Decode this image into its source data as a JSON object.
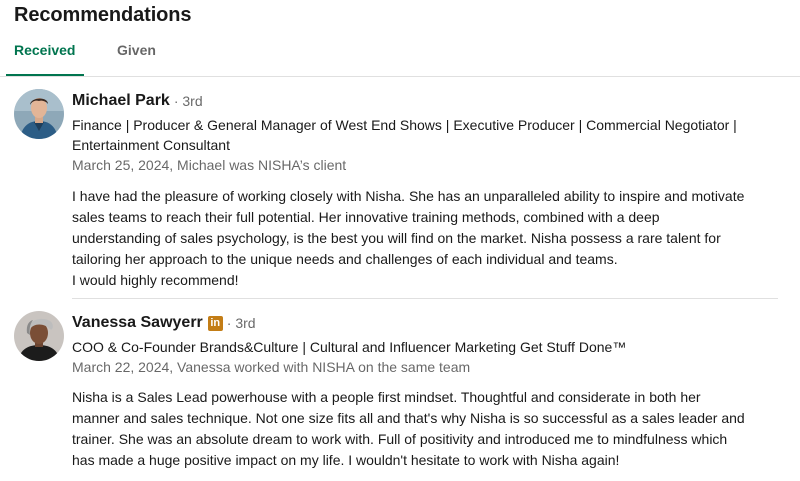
{
  "section": {
    "title": "Recommendations"
  },
  "tabs": [
    {
      "label": "Received",
      "active": true
    },
    {
      "label": "Given",
      "active": false
    }
  ],
  "accent_color": "#01754f",
  "recommendations": [
    {
      "name": "Michael Park",
      "degree": "· 3rd",
      "headline": "Finance | Producer & General Manager of West End Shows | Executive Producer | Commercial Negotiator | Entertainment Consultant",
      "meta": "March 25, 2024, Michael was NISHA’s client",
      "body_lines": [
        "I have had the pleasure of working closely with Nisha. She has an unparalleled ability to inspire and motivate",
        "sales teams to reach their full potential. Her innovative training methods, combined with a deep",
        "understanding of sales psychology, is the best you will find on the market. Nisha possess a rare talent for",
        "tailoring her approach to the unique needs and challenges of each individual and teams.",
        "I would highly recommend!"
      ]
    },
    {
      "name": "Vanessa Sawyerr",
      "badge": "in",
      "degree": "· 3rd",
      "headline": "COO & Co-Founder Brands&Culture | Cultural and Influencer Marketing Get Stuff Done™",
      "meta": "March 22, 2024, Vanessa worked with NISHA on the same team",
      "body_lines": [
        "Nisha is a Sales Lead powerhouse with a people first mindset. Thoughtful and considerate in both her",
        "manner and sales technique. Not one size fits all and that's why Nisha is so successful as a sales leader and",
        "trainer. She was an absolute dream to work with. Full of positivity and introduced me to mindfulness which",
        "has made a huge positive impact on my life. I wouldn't hesitate to work with Nisha again!"
      ]
    }
  ]
}
